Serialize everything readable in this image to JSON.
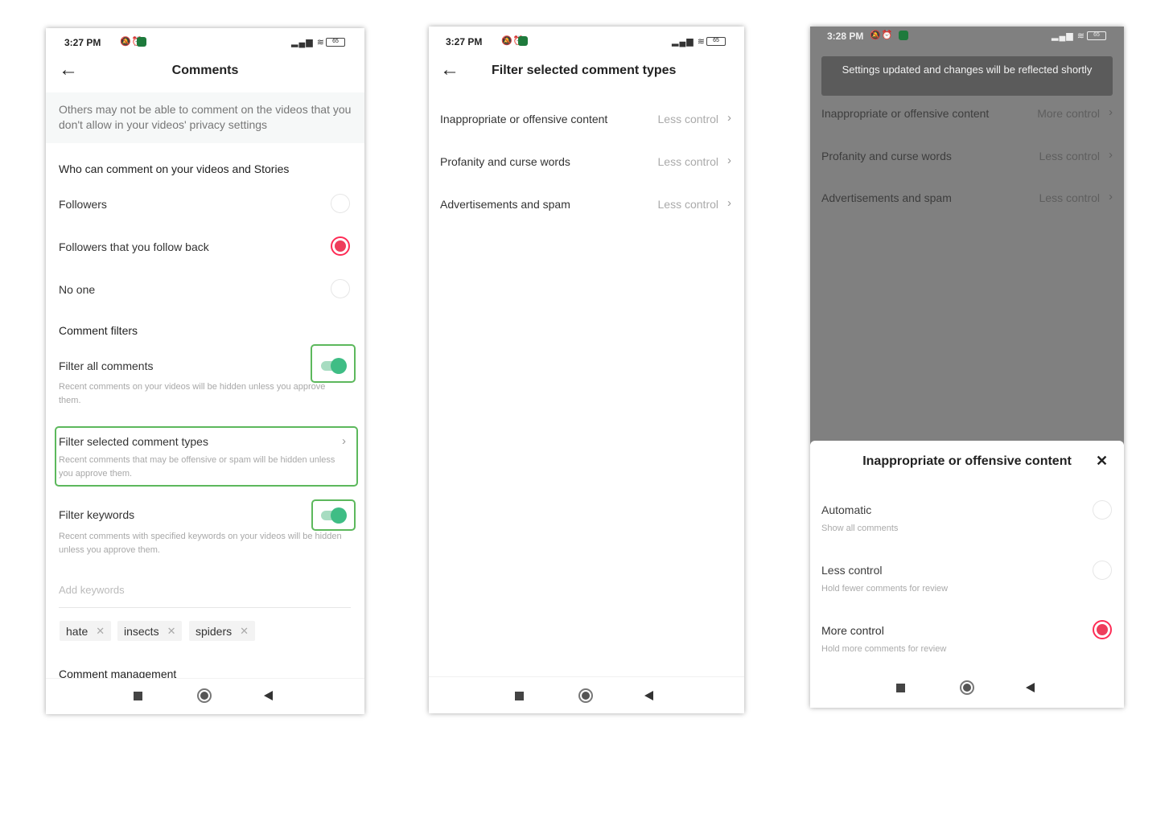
{
  "screen1": {
    "status": {
      "time": "3:27 PM",
      "battery": "65"
    },
    "header": {
      "title": "Comments",
      "back_icon": "arrow-left-icon"
    },
    "info": "Others may not be able to comment on the videos that you don't allow in your videos' privacy settings",
    "who_title": "Who can comment on your videos and Stories",
    "options": [
      {
        "label": "Followers",
        "selected": false
      },
      {
        "label": "Followers that you follow back",
        "selected": true
      },
      {
        "label": "No one",
        "selected": false
      }
    ],
    "filters_title": "Comment filters",
    "filter_all": {
      "label": "Filter all comments",
      "desc": "Recent comments on your videos will be hidden unless you approve them.",
      "on": true
    },
    "filter_selected": {
      "label": "Filter selected comment types",
      "desc": "Recent comments that may be offensive or spam will be hidden unless you approve them."
    },
    "filter_keywords": {
      "label": "Filter keywords",
      "desc": "Recent comments with specified keywords on your videos will be hidden unless you approve them.",
      "on": true
    },
    "keyword_placeholder": "Add keywords",
    "keywords": [
      "hate",
      "insects",
      "spiders"
    ],
    "management_title": "Comment management"
  },
  "screen2": {
    "status": {
      "time": "3:27 PM",
      "battery": "65"
    },
    "header": {
      "title": "Filter selected comment types"
    },
    "rows": [
      {
        "label": "Inappropriate or offensive content",
        "value": "Less control"
      },
      {
        "label": "Profanity and curse words",
        "value": "Less control"
      },
      {
        "label": "Advertisements and spam",
        "value": "Less control"
      }
    ]
  },
  "screen3": {
    "status": {
      "time": "3:28 PM",
      "battery": "65"
    },
    "toast": "Settings updated and changes will be reflected shortly",
    "rows": [
      {
        "label": "Inappropriate or offensive content",
        "value": "More control"
      },
      {
        "label": "Profanity and curse words",
        "value": "Less control"
      },
      {
        "label": "Advertisements and spam",
        "value": "Less control"
      }
    ],
    "sheet": {
      "title": "Inappropriate or offensive content",
      "options": [
        {
          "label": "Automatic",
          "desc": "Show all comments",
          "selected": false
        },
        {
          "label": "Less control",
          "desc": "Hold fewer comments for review",
          "selected": false
        },
        {
          "label": "More control",
          "desc": "Hold more comments for review",
          "selected": true
        }
      ]
    }
  },
  "colors": {
    "accent": "#fe2c55",
    "toggle": "#3fbd85",
    "highlight": "#5cb85c",
    "overlay": "#808080"
  }
}
